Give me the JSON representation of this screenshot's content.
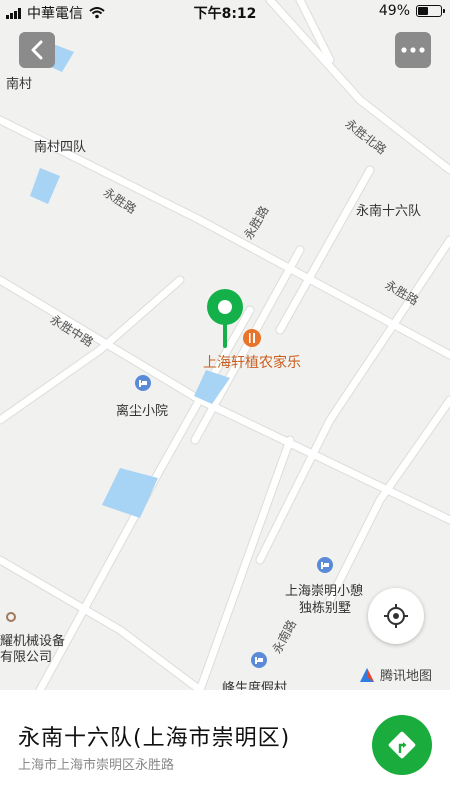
{
  "status_bar": {
    "carrier": "中華電信",
    "time": "下午8:12",
    "battery_pct": "49%",
    "battery_level": 0.49,
    "signal_bars": 4,
    "wifi_icon": "wifi-icon"
  },
  "map": {
    "villages": [
      {
        "name": "南村"
      },
      {
        "name": "南村四队"
      },
      {
        "name": "永南十六队"
      },
      {
        "name": "离尘小院"
      },
      {
        "name": "上海崇明小憩"
      },
      {
        "name": "独栋别墅"
      },
      {
        "name": "峰生度假村"
      },
      {
        "name": "耀机械设备"
      },
      {
        "name": "有限公司"
      }
    ],
    "roads": [
      {
        "name": "永胜北路"
      },
      {
        "name": "永胜路"
      },
      {
        "name": "永胜路"
      },
      {
        "name": "永胜路"
      },
      {
        "name": "永胜中路"
      },
      {
        "name": "永南路"
      }
    ],
    "selected_poi": "上海轩植农家乐",
    "watermark": "腾讯地图"
  },
  "bottom_panel": {
    "title": "永南十六队(上海市崇明区)",
    "address": "上海市上海市崇明区永胜路"
  },
  "colors": {
    "pin": "#14b04a",
    "nav_button": "#1aad3d",
    "water": "#a7d3f5",
    "roads": "#ffffff",
    "map_bg": "#f1f1ef",
    "poi_orange": "#e8732b"
  }
}
